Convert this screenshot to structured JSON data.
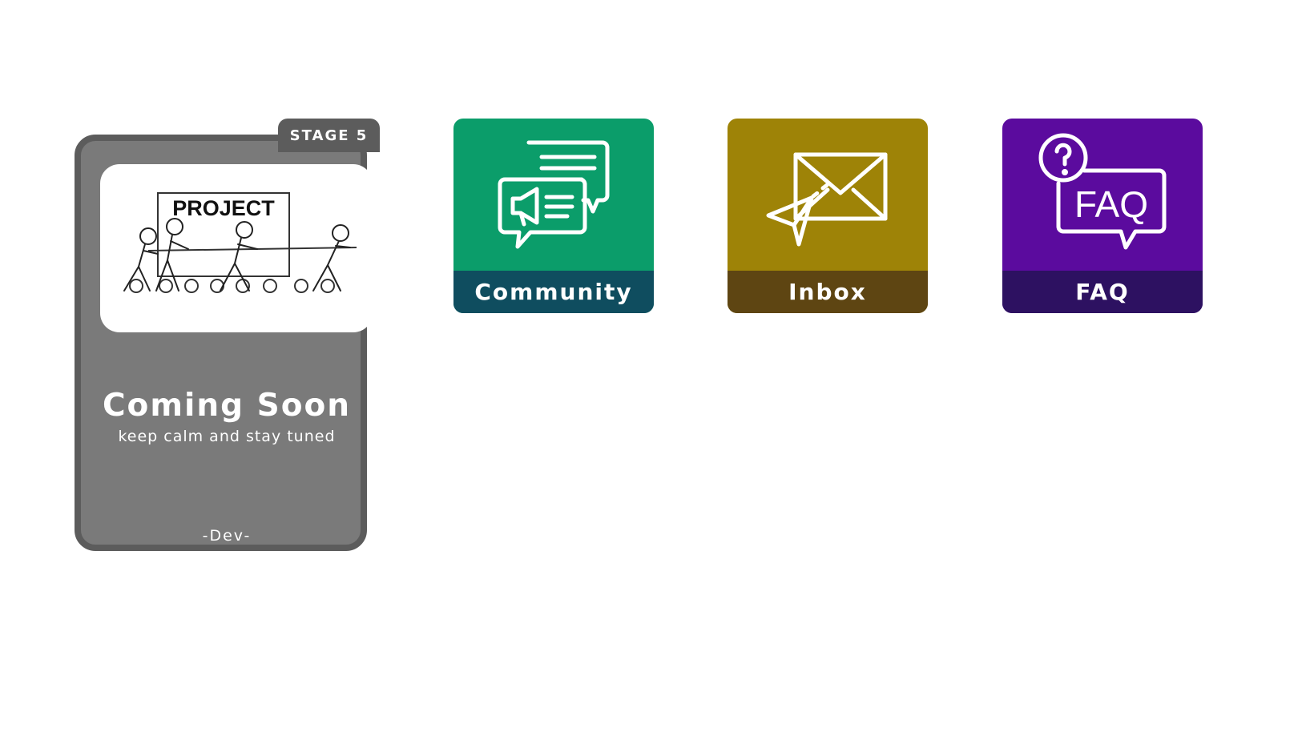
{
  "stage_card": {
    "badge": "STAGE 5",
    "illustration_title": "PROJECT",
    "title": "Coming Soon",
    "subtitle": "keep calm and stay tuned",
    "author": "-Dev-"
  },
  "tiles": [
    {
      "label": "Community",
      "icon": "chat-megaphone-icon",
      "color": "#0b9d6a",
      "label_color": "#0f4d5f"
    },
    {
      "label": "Inbox",
      "icon": "envelope-paper-plane-icon",
      "color": "#9e8307",
      "label_color": "#5e4512"
    },
    {
      "label": "FAQ",
      "icon": "faq-question-bubble-icon",
      "color": "#5b0b9e",
      "label_color": "#2d1161"
    }
  ],
  "faq_icon_text": "FAQ"
}
